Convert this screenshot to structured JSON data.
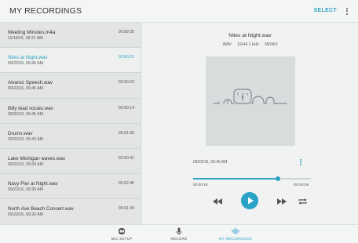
{
  "header": {
    "title": "MY RECORDINGS",
    "select_label": "SELECT",
    "menu_icon": "more-vert-icon"
  },
  "recordings": [
    {
      "name": "Meeting Minutes.m4a",
      "date": "11/10/16, 09:37 AM",
      "duration": "00:09:35",
      "active": false
    },
    {
      "name": "Niles at Night.wav",
      "date": "09/22/16, 09:46 AM",
      "duration": "00:00:22",
      "active": true
    },
    {
      "name": "Alvarez Speech.wav",
      "date": "09/22/16, 09:45 AM",
      "duration": "00:00:23",
      "active": false
    },
    {
      "name": "Billy lead vocals.wav",
      "date": "09/22/16, 09:45 AM",
      "duration": "00:00:14",
      "active": false
    },
    {
      "name": "Drums.wav",
      "date": "09/22/16, 09:43 AM",
      "duration": "00:01:58",
      "active": false
    },
    {
      "name": "Lake Michigan waves.wav",
      "date": "09/22/16, 09:33 AM",
      "duration": "00:00:41",
      "active": false
    },
    {
      "name": "Navy Pier at Night.wav",
      "date": "09/22/16, 09:30 AM",
      "duration": "00:02:45",
      "active": false
    },
    {
      "name": "North Ave Beach Concert.wav",
      "date": "09/22/16, 09:26 AM",
      "duration": "00:01:49",
      "active": false
    }
  ],
  "player": {
    "title": "Niles at Night.wav",
    "format": "WAV",
    "sample_rate": "16/44.1 kHz",
    "channels": "MONO",
    "recorded": "09/22/16, 09:46 AM",
    "elapsed": "00:00:16",
    "remaining": "-00:00:06",
    "progress": 0.72,
    "artwork_icon": "microphone-gear-illustration",
    "controls": [
      "rewind-icon",
      "play-icon",
      "fast-forward-icon",
      "loop-icon"
    ]
  },
  "nav": {
    "tabs": [
      {
        "label": "MIC SETUP",
        "icon": "mic-setup-icon",
        "active": false
      },
      {
        "label": "RECORD",
        "icon": "microphone-icon",
        "active": false
      },
      {
        "label": "MY RECORDINGS",
        "icon": "waveform-icon",
        "active": true
      }
    ]
  },
  "colors": {
    "accent": "#2aa3c6",
    "list_bg": "#e3e5e5",
    "active_row_bg": "#eef0f0",
    "artwork_bg": "#d9dcdd"
  }
}
